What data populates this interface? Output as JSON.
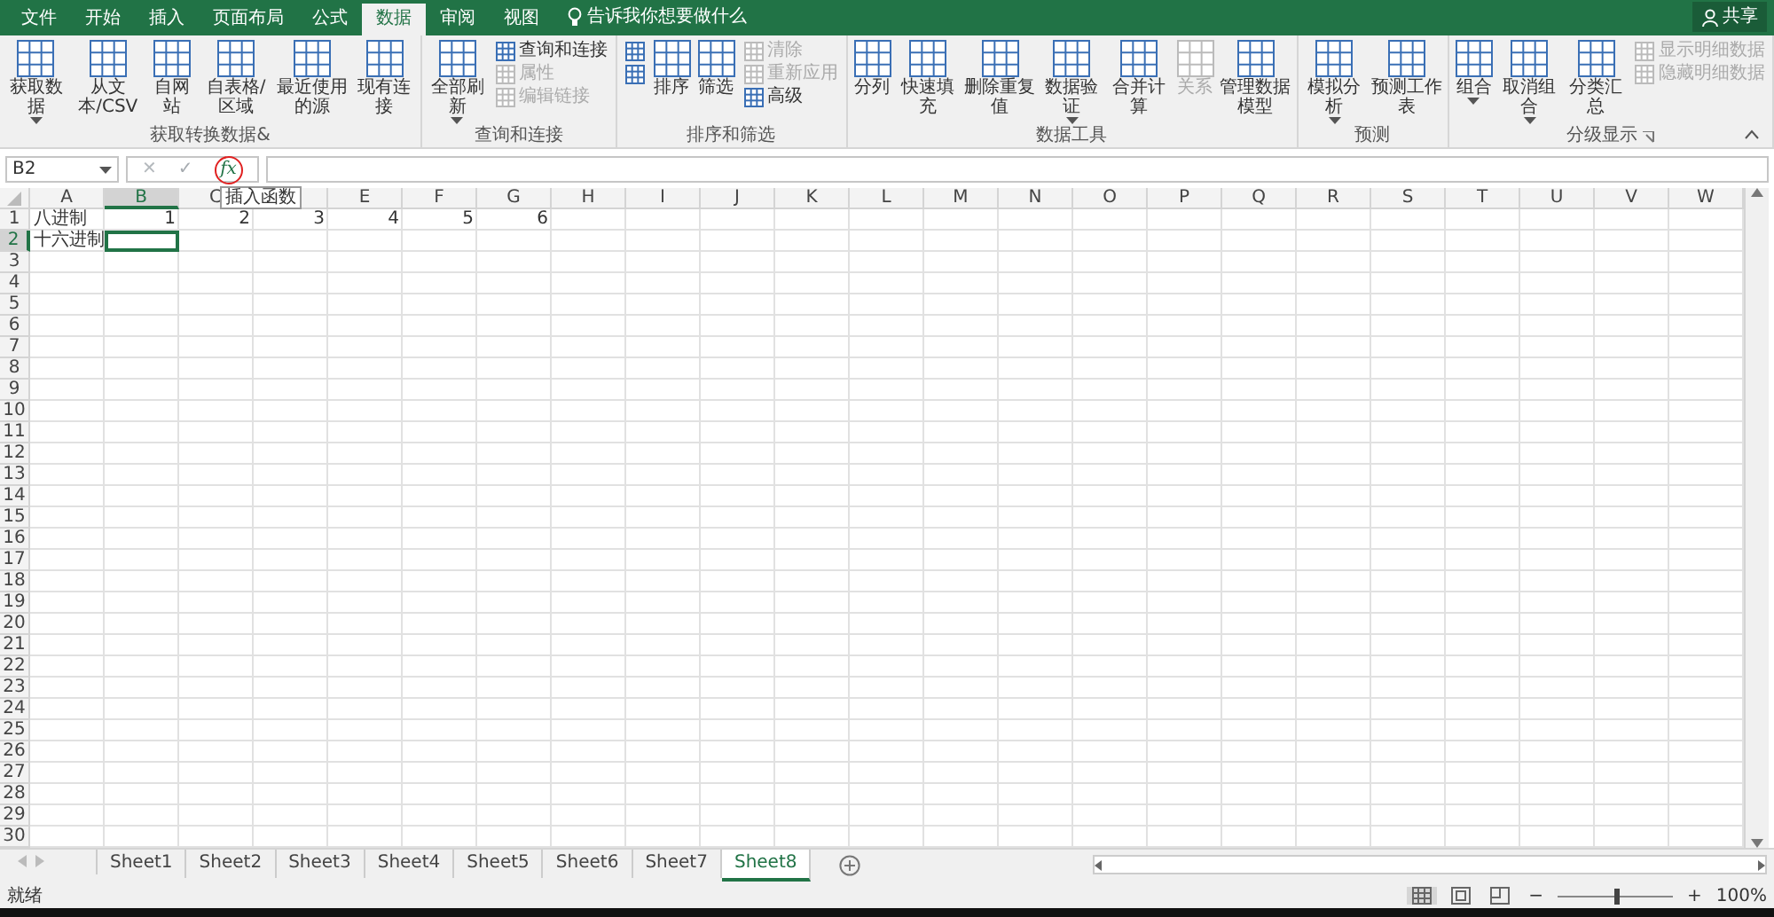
{
  "title_bar": {
    "tabs": [
      {
        "label": "文件",
        "selected": false
      },
      {
        "label": "开始",
        "selected": false
      },
      {
        "label": "插入",
        "selected": false
      },
      {
        "label": "页面布局",
        "selected": false
      },
      {
        "label": "公式",
        "selected": false
      },
      {
        "label": "数据",
        "selected": true
      },
      {
        "label": "审阅",
        "selected": false
      },
      {
        "label": "视图",
        "selected": false
      }
    ],
    "tell_me": "告诉我你想要做什么",
    "share": "共享"
  },
  "ribbon": {
    "groups": [
      {
        "label": "获取转换数据&",
        "launcher": false,
        "items": [
          {
            "kind": "large",
            "label": "获取数据",
            "dropdown": true,
            "disabled": false
          },
          {
            "kind": "large",
            "label": "从文本/CSV",
            "dropdown": false,
            "disabled": false
          },
          {
            "kind": "large",
            "label": "自网站",
            "dropdown": false,
            "disabled": false
          },
          {
            "kind": "large",
            "label": "自表格/区域",
            "dropdown": false,
            "disabled": false
          },
          {
            "kind": "large",
            "label": "最近使用的源",
            "dropdown": false,
            "disabled": false
          },
          {
            "kind": "large",
            "label": "现有连接",
            "dropdown": false,
            "disabled": false
          }
        ]
      },
      {
        "label": "查询和连接",
        "launcher": false,
        "items": [
          {
            "kind": "large",
            "label": "全部刷新",
            "dropdown": true,
            "disabled": false
          },
          {
            "kind": "stack",
            "items": [
              {
                "label": "查询和连接",
                "disabled": false
              },
              {
                "label": "属性",
                "disabled": true
              },
              {
                "label": "编辑链接",
                "disabled": true
              }
            ]
          }
        ]
      },
      {
        "label": "排序和筛选",
        "launcher": false,
        "items": [
          {
            "kind": "stack",
            "items": [
              {
                "disabled": false
              },
              {
                "disabled": false
              }
            ]
          },
          {
            "kind": "large",
            "label": "排序",
            "dropdown": false,
            "disabled": false
          },
          {
            "kind": "large",
            "label": "筛选",
            "dropdown": false,
            "disabled": false
          },
          {
            "kind": "stack",
            "items": [
              {
                "label": "清除",
                "disabled": true
              },
              {
                "label": "重新应用",
                "disabled": true
              },
              {
                "label": "高级",
                "disabled": false
              }
            ]
          }
        ]
      },
      {
        "label": "数据工具",
        "launcher": false,
        "items": [
          {
            "kind": "large",
            "label": "分列",
            "dropdown": false,
            "disabled": false
          },
          {
            "kind": "large",
            "label": "快速填充",
            "dropdown": false,
            "disabled": false
          },
          {
            "kind": "large",
            "label": "删除重复值",
            "dropdown": false,
            "disabled": false
          },
          {
            "kind": "large",
            "label": "数据验证",
            "dropdown": true,
            "disabled": false
          },
          {
            "kind": "large",
            "label": "合并计算",
            "dropdown": false,
            "disabled": false
          },
          {
            "kind": "large",
            "label": "关系",
            "dropdown": false,
            "disabled": true
          },
          {
            "kind": "large",
            "label": "管理数据模型",
            "dropdown": false,
            "disabled": false
          }
        ]
      },
      {
        "label": "预测",
        "launcher": false,
        "items": [
          {
            "kind": "large",
            "label": "模拟分析",
            "dropdown": true,
            "disabled": false
          },
          {
            "kind": "large",
            "label": "预测工作表",
            "dropdown": false,
            "disabled": false
          }
        ]
      },
      {
        "label": "分级显示",
        "launcher": true,
        "items": [
          {
            "kind": "large",
            "label": "组合",
            "dropdown": true,
            "disabled": false
          },
          {
            "kind": "large",
            "label": "取消组合",
            "dropdown": true,
            "disabled": false
          },
          {
            "kind": "large",
            "label": "分类汇总",
            "dropdown": false,
            "disabled": false
          },
          {
            "kind": "stack",
            "items": [
              {
                "label": "显示明细数据",
                "disabled": true
              },
              {
                "label": "隐藏明细数据",
                "disabled": true
              }
            ]
          }
        ]
      }
    ]
  },
  "formula_bar": {
    "name_box": "B2",
    "cancel": "✕",
    "enter": "✓",
    "fx": "fx",
    "fx_circled": true,
    "tooltip": "插入函数"
  },
  "sheet": {
    "columns": [
      {
        "label": "A",
        "selected": false
      },
      {
        "label": "B",
        "selected": true
      },
      {
        "label": "C",
        "selected": false
      },
      {
        "selected": false
      },
      {
        "label": "E",
        "selected": false
      },
      {
        "label": "F",
        "selected": false
      },
      {
        "label": "G",
        "selected": false
      },
      {
        "label": "H",
        "selected": false
      },
      {
        "label": "I",
        "selected": false
      },
      {
        "label": "J",
        "selected": false
      },
      {
        "label": "K",
        "selected": false
      },
      {
        "label": "L",
        "selected": false
      },
      {
        "label": "M",
        "selected": false
      },
      {
        "label": "N",
        "selected": false
      },
      {
        "label": "O",
        "selected": false
      },
      {
        "label": "P",
        "selected": false
      },
      {
        "label": "Q",
        "selected": false
      },
      {
        "label": "R",
        "selected": false
      },
      {
        "label": "S",
        "selected": false
      },
      {
        "label": "T",
        "selected": false
      },
      {
        "label": "U",
        "selected": false
      },
      {
        "label": "V",
        "selected": false
      },
      {
        "label": "W",
        "selected": false
      }
    ],
    "rows": [
      {
        "label": "1",
        "selected": false,
        "cells": [
          {
            "text": "八进制",
            "kind": "text"
          },
          {
            "text": "1",
            "kind": "number"
          },
          {
            "text": "2",
            "kind": "number"
          },
          {
            "text": "3",
            "kind": "number"
          },
          {
            "text": "4",
            "kind": "number"
          },
          {
            "text": "5",
            "kind": "number"
          },
          {
            "text": "6",
            "kind": "number"
          }
        ]
      },
      {
        "label": "2",
        "selected": true,
        "cells": [
          {
            "text": "十六进制",
            "kind": "text"
          }
        ]
      },
      {
        "label": "3",
        "selected": false
      },
      {
        "label": "4",
        "selected": false
      },
      {
        "label": "5",
        "selected": false
      },
      {
        "label": "6",
        "selected": false
      },
      {
        "label": "7",
        "selected": false
      },
      {
        "label": "8",
        "selected": false
      },
      {
        "label": "9",
        "selected": false
      },
      {
        "label": "10",
        "selected": false
      },
      {
        "label": "11",
        "selected": false
      },
      {
        "label": "12",
        "selected": false
      },
      {
        "label": "13",
        "selected": false
      },
      {
        "label": "14",
        "selected": false
      },
      {
        "label": "15",
        "selected": false
      },
      {
        "label": "16",
        "selected": false
      },
      {
        "label": "17",
        "selected": false
      },
      {
        "label": "18",
        "selected": false
      },
      {
        "label": "19",
        "selected": false
      },
      {
        "label": "20",
        "selected": false
      },
      {
        "label": "21",
        "selected": false
      },
      {
        "label": "22",
        "selected": false
      },
      {
        "label": "23",
        "selected": false
      },
      {
        "label": "24",
        "selected": false
      },
      {
        "label": "25",
        "selected": false
      },
      {
        "label": "26",
        "selected": false
      },
      {
        "label": "27",
        "selected": false
      },
      {
        "label": "28",
        "selected": false
      },
      {
        "label": "29",
        "selected": false
      },
      {
        "label": "30",
        "selected": false
      }
    ]
  },
  "sheet_tabs": [
    {
      "label": "Sheet1",
      "selected": false
    },
    {
      "label": "Sheet2",
      "selected": false
    },
    {
      "label": "Sheet3",
      "selected": false
    },
    {
      "label": "Sheet4",
      "selected": false
    },
    {
      "label": "Sheet5",
      "selected": false
    },
    {
      "label": "Sheet6",
      "selected": false
    },
    {
      "label": "Sheet7",
      "selected": false
    },
    {
      "label": "Sheet8",
      "selected": true
    }
  ],
  "status_bar": {
    "text": "就绪",
    "views": [
      {
        "selected": true
      },
      {
        "selected": false
      },
      {
        "selected": false
      }
    ],
    "zoom_minus": "−",
    "zoom_plus": "+",
    "zoom": {
      "level": 0.5
    },
    "zoom_label": "100%"
  }
}
